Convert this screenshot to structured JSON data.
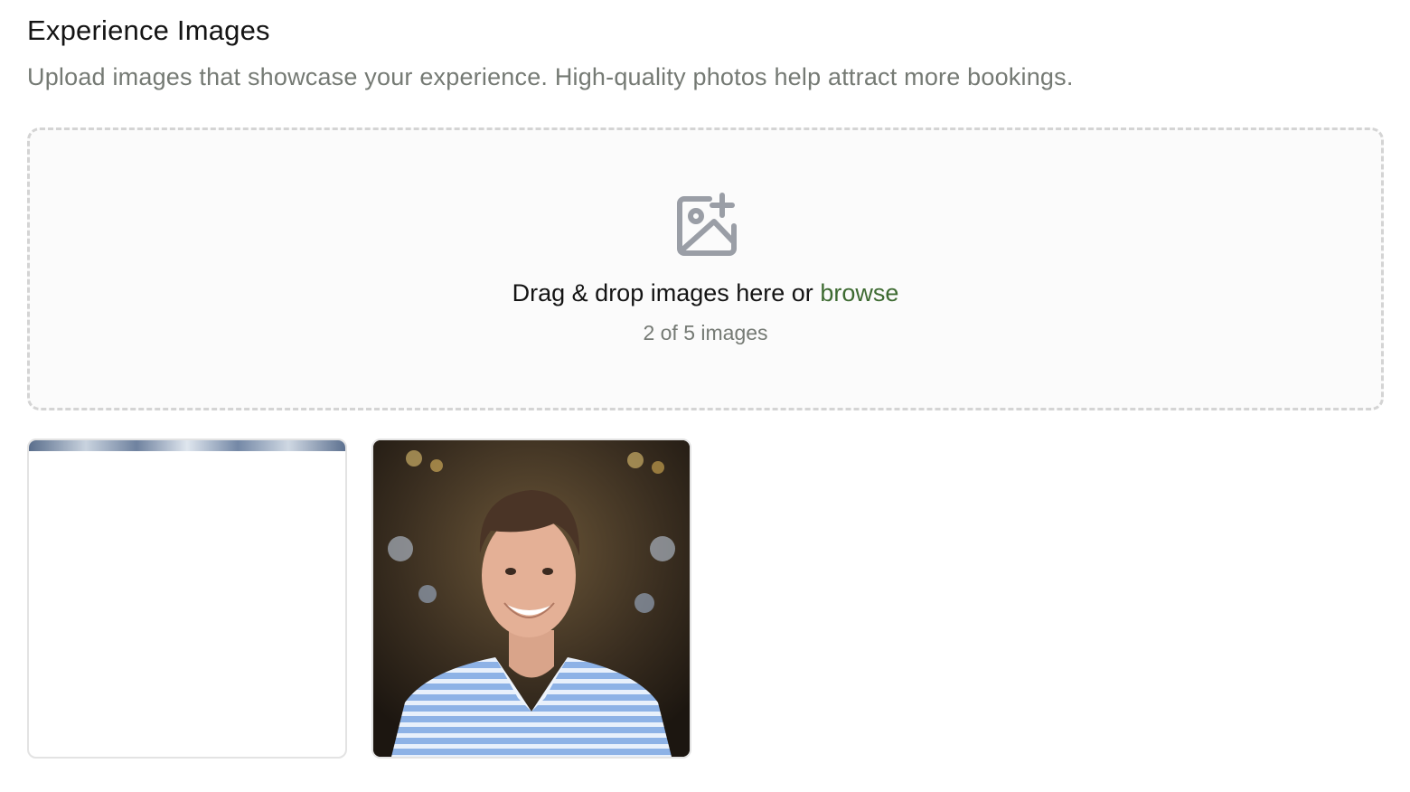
{
  "section": {
    "title": "Experience Images",
    "subtitle": "Upload images that showcase your experience. High-quality photos help attract more bookings."
  },
  "dropzone": {
    "icon": "image-plus-icon",
    "prompt": "Drag & drop images here or ",
    "browse_label": "browse",
    "count_text": "2 of 5 images"
  },
  "images": [
    {
      "name": "uploaded-image-1",
      "kind": "landscape-photo-loading"
    },
    {
      "name": "uploaded-image-2",
      "kind": "portrait-photo"
    }
  ],
  "colors": {
    "accent": "#3e6b32",
    "muted_text": "#757a74",
    "dashed_border": "#d4d4d4"
  }
}
